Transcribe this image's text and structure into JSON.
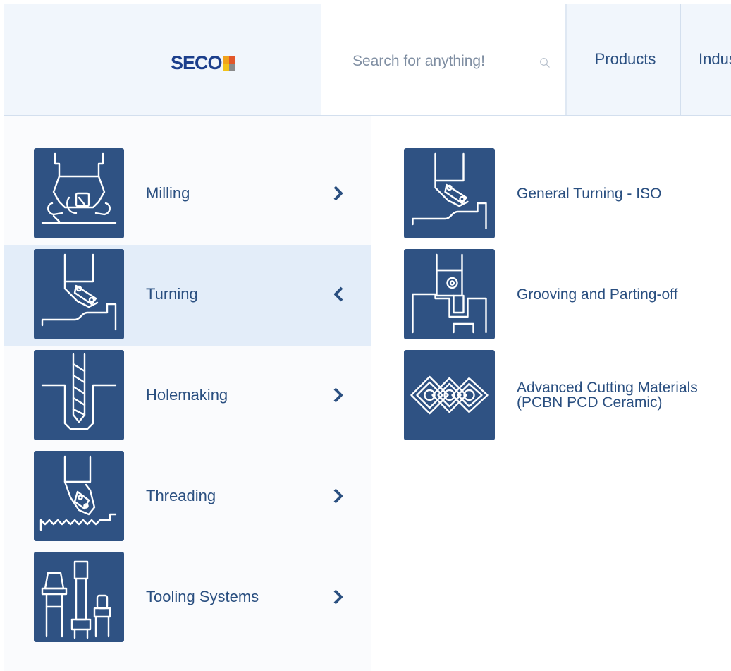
{
  "header": {
    "logo_text": "SECO",
    "logo_colors": [
      "#f0a21c",
      "#e2572a",
      "#f2c21a",
      "#8a8a8a"
    ],
    "search": {
      "placeholder": "Search for anything!",
      "value": ""
    },
    "nav": [
      {
        "label": "Products"
      },
      {
        "label": "Industries"
      }
    ]
  },
  "categories": [
    {
      "label": "Milling",
      "icon": "milling-icon",
      "chevron": "chevron-right-icon",
      "active": false
    },
    {
      "label": "Turning",
      "icon": "turning-icon",
      "chevron": "chevron-left-icon",
      "active": true
    },
    {
      "label": "Holemaking",
      "icon": "holemaking-icon",
      "chevron": "chevron-right-icon",
      "active": false
    },
    {
      "label": "Threading",
      "icon": "threading-icon",
      "chevron": "chevron-right-icon",
      "active": false
    },
    {
      "label": "Tooling Systems",
      "icon": "tooling-systems-icon",
      "chevron": "chevron-right-icon",
      "active": false
    }
  ],
  "subcategories": [
    {
      "label": "General Turning - ISO",
      "icon": "general-turning-icon"
    },
    {
      "label": "Grooving and Parting-off",
      "icon": "grooving-parting-icon"
    },
    {
      "label": "Advanced Cutting Materials (PCBN PCD Ceramic)",
      "icon": "cutting-materials-icon"
    }
  ],
  "colors": {
    "brand_blue": "#1c3f8c",
    "tile_blue": "#2f5283",
    "text_blue": "#2a4f80",
    "active_bg": "#e3edf9",
    "header_bg": "#f1f6fc"
  }
}
